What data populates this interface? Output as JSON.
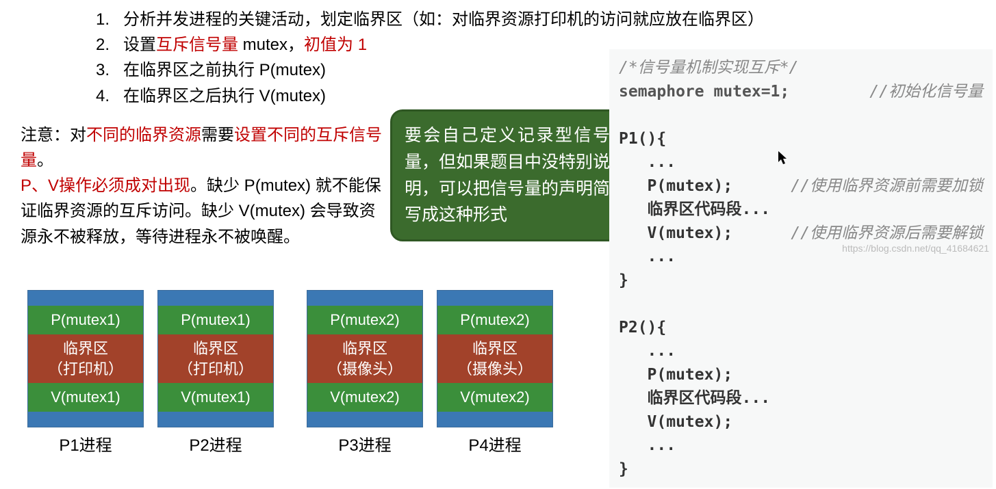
{
  "list": {
    "i1": {
      "n": "1.",
      "a": "分析并发进程的关键活动，划定临界区（如：对临界资源打印机的访问就应放在临界区）"
    },
    "i2": {
      "n": "2.",
      "a": "设置",
      "b": "互斥信号量",
      "c": " mutex，",
      "d": "初值为 1"
    },
    "i3": {
      "n": "3.",
      "a": "在临界区之前执行 P(mutex)"
    },
    "i4": {
      "n": "4.",
      "a": "在临界区之后执行 V(mutex)"
    }
  },
  "note": {
    "a": "注意：对",
    "b": "不同的临界资源",
    "c": "需要",
    "d": "设置不同的互斥信号量",
    "e": "。",
    "f": "P、V操作必须成对出现",
    "g": "。缺少 P(mutex) 就不能保证临界资源的互斥访问。缺少 V(mutex) 会导致资源永不被释放，等待进程永不被唤醒。"
  },
  "bubble": "要会自己定义记录型信号量，但如果题目中没特别说明，可以把信号量的声明简写成这种形式",
  "code": {
    "c0": "/*信号量机制实现互斥*/",
    "c1a": "semaphore mutex=1;",
    "c1b": "//初始化信号量",
    "p1h": "P1(){",
    "d1": "   ...",
    "pm": "   P(mutex);",
    "pmC": "//使用临界资源前需要加锁",
    "cs": "   临界区代码段...",
    "vm": "   V(mutex);",
    "vmC": "//使用临界资源后需要解锁",
    "d2": "   ...",
    "rb": "}",
    "p2h": "P2(){",
    "p2a": "   ...",
    "p2b": "   P(mutex);",
    "p2c": "   临界区代码段...",
    "p2d": "   V(mutex);",
    "p2e": "   ...",
    "p2f": "}"
  },
  "proc": {
    "p1": {
      "top": "P(mutex1)",
      "mid1": "临界区",
      "mid2": "（打印机）",
      "bot": "V(mutex1)",
      "lab": "P1进程"
    },
    "p2": {
      "top": "P(mutex1)",
      "mid1": "临界区",
      "mid2": "（打印机）",
      "bot": "V(mutex1)",
      "lab": "P2进程"
    },
    "p3": {
      "top": "P(mutex2)",
      "mid1": "临界区",
      "mid2": "（摄像头）",
      "bot": "V(mutex2)",
      "lab": "P3进程"
    },
    "p4": {
      "top": "P(mutex2)",
      "mid1": "临界区",
      "mid2": "（摄像头）",
      "bot": "V(mutex2)",
      "lab": "P4进程"
    }
  },
  "watermark": "https://blog.csdn.net/qq_41684621"
}
